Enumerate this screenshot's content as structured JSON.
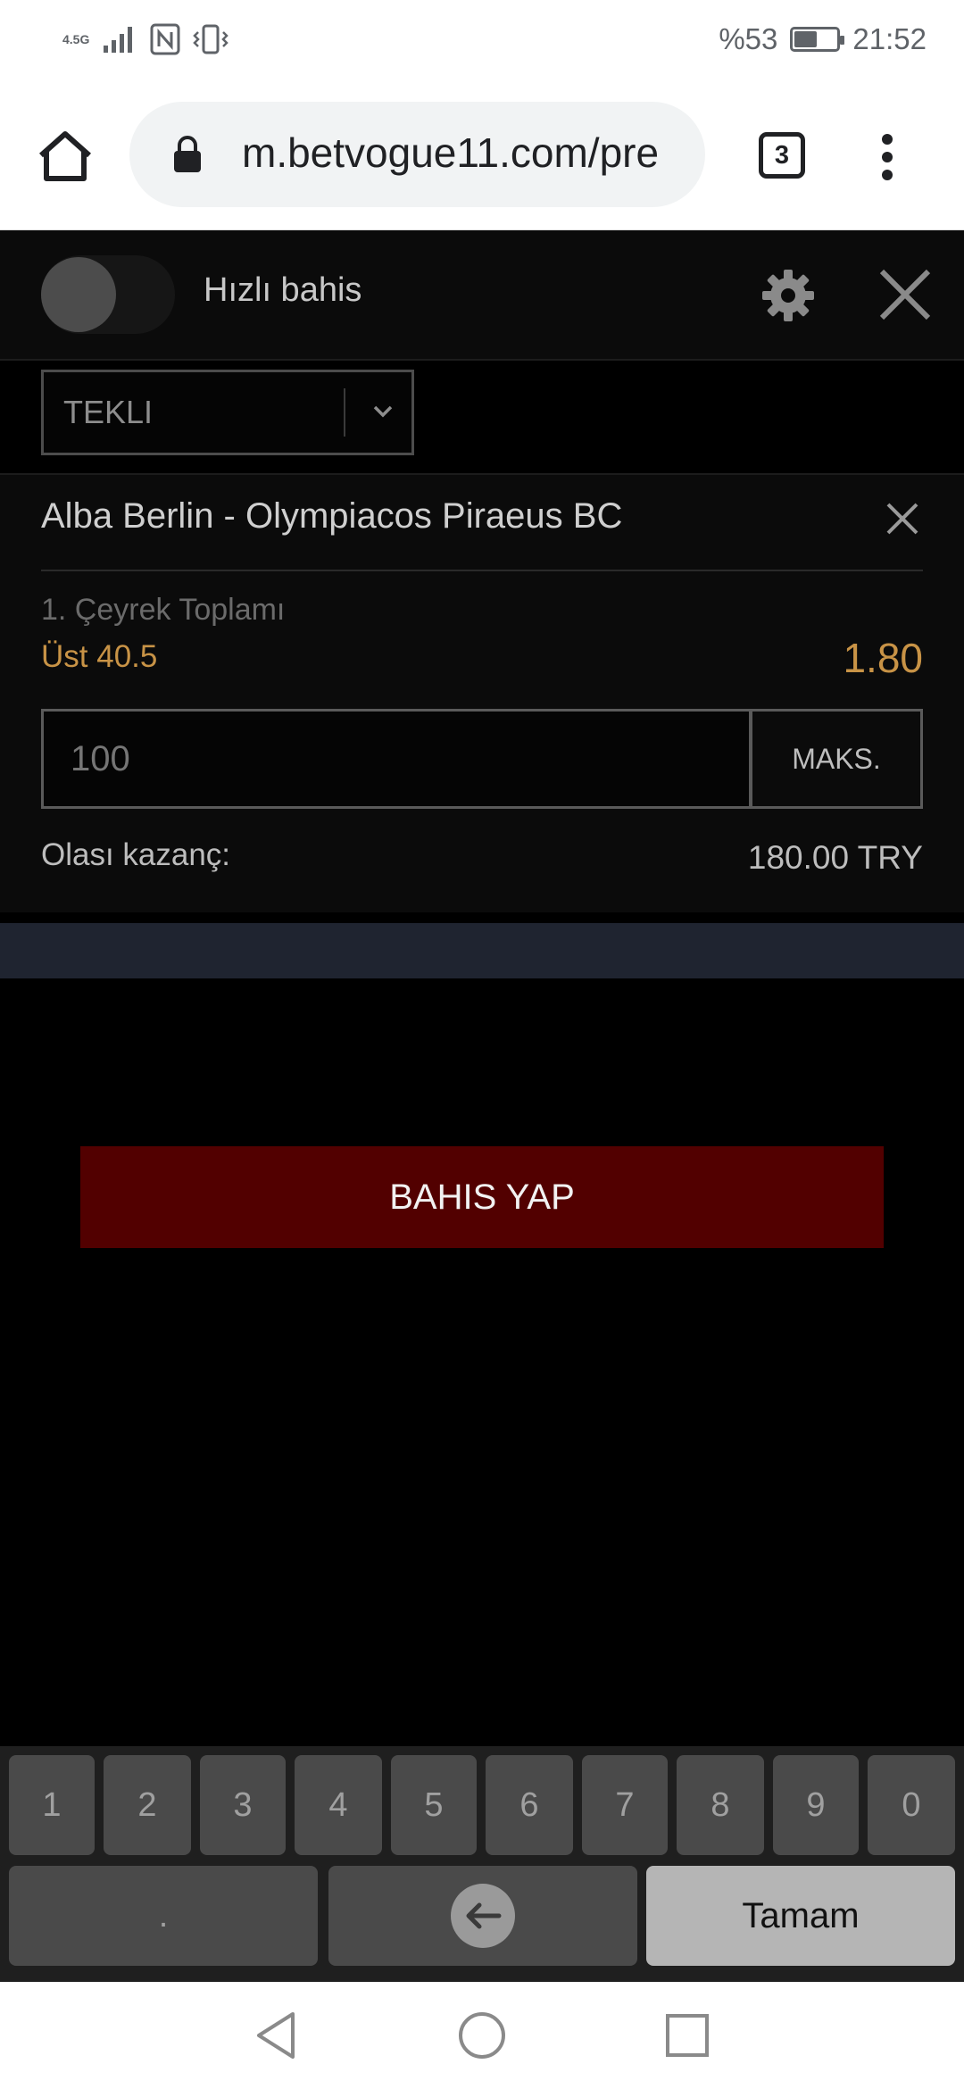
{
  "status_bar": {
    "network": "4.5G",
    "battery": "%53",
    "battery_level": 0.53,
    "time": "21:52"
  },
  "browser": {
    "url": "m.betvogue11.com/pre",
    "tab_count": "3"
  },
  "betslip": {
    "quick_bet_label": "Hızlı bahis",
    "bet_type": "TEKLI",
    "match": "Alba Berlin - Olympiacos Piraeus BC",
    "market": "1. Çeyrek Toplamı",
    "selection": "Üst 40.5",
    "odds": "1.80",
    "stake_placeholder": "100",
    "max_label": "MAKS.",
    "payout_label": "Olası kazanç:",
    "payout_value": "180.00 TRY",
    "place_bet_label": "BAHIS YAP"
  },
  "keyboard": {
    "digits": [
      "1",
      "2",
      "3",
      "4",
      "5",
      "6",
      "7",
      "8",
      "9",
      "0"
    ],
    "decimal": ".",
    "done_label": "Tamam"
  },
  "colors": {
    "accent_odds": "#c89346",
    "place_bet_bg": "#520000"
  }
}
